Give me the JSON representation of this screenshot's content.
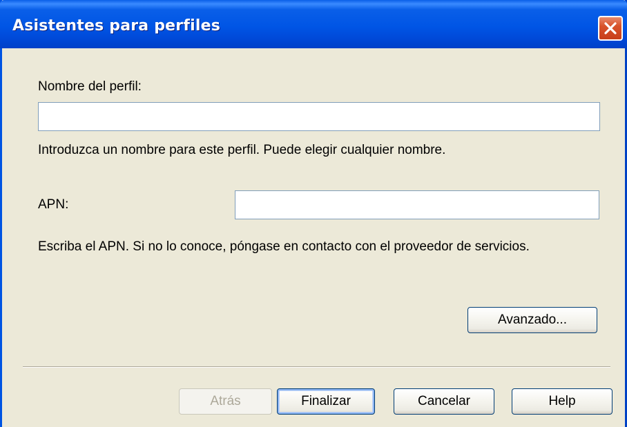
{
  "window": {
    "title": "Asistentes para perfiles"
  },
  "form": {
    "profile_name_label": "Nombre del perfil:",
    "profile_name_value": "",
    "profile_name_help": "Introduzca un nombre para este perfil. Puede elegir cualquier nombre.",
    "apn_label": "APN:",
    "apn_value": "",
    "apn_help": "Escriba el APN.  Si no lo conoce, póngase en contacto con el proveedor de servicios.",
    "advanced_label": "Avanzado..."
  },
  "footer": {
    "back_label": "Atrás",
    "finish_label": "Finalizar",
    "cancel_label": "Cancelar",
    "help_label": "Help"
  },
  "colors": {
    "titlebar": "#0055E5",
    "dialog_bg": "#ECE9D8",
    "close_button": "#D8532B",
    "input_border": "#7F9DB9",
    "disabled_text": "#ACA899"
  },
  "icons": {
    "close": "close-icon"
  }
}
